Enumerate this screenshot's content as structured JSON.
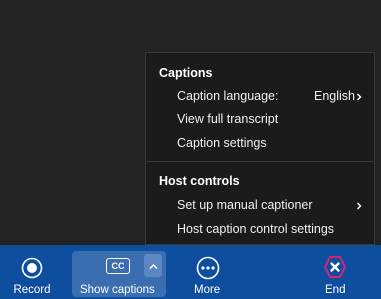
{
  "captions_menu": {
    "title": "Captions",
    "language_label": "Caption language:",
    "language_value": "English",
    "view_transcript": "View full transcript",
    "caption_settings": "Caption settings"
  },
  "host_menu": {
    "title": "Host controls",
    "manual_captioner": "Set up manual captioner",
    "host_caption_settings": "Host caption control settings"
  },
  "toolbar": {
    "record_label": "Record",
    "captions_label": "Show captions",
    "cc_badge": "CC",
    "more_label": "More",
    "end_label": "End"
  },
  "colors": {
    "toolbar_bg": "#0d4f9e",
    "menu_bg": "#1b1b1b",
    "end_accent": "#d0267a"
  }
}
